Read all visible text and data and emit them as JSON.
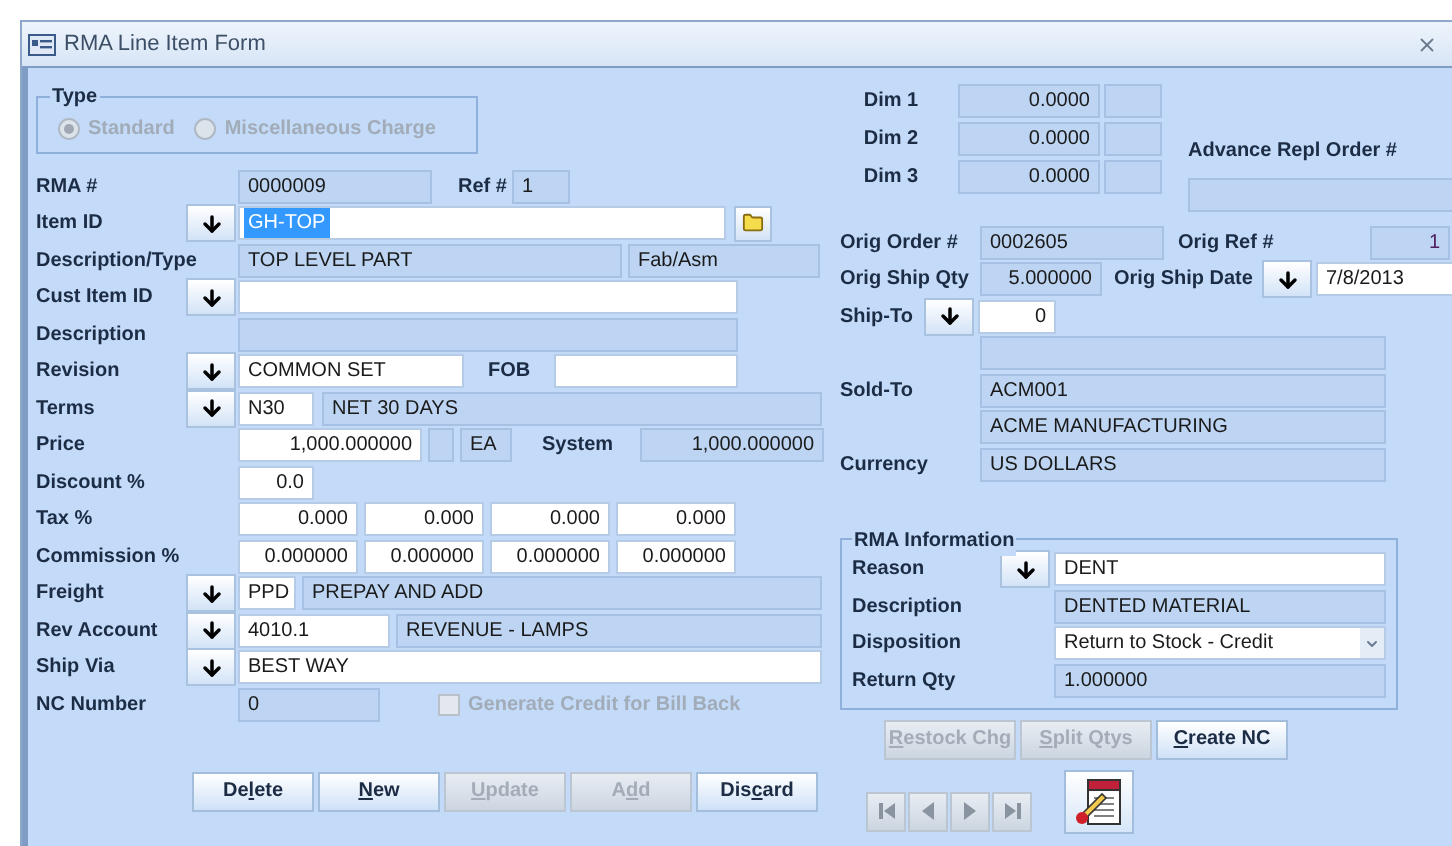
{
  "window": {
    "title": "RMA Line Item Form"
  },
  "type_group": {
    "label": "Type",
    "disabled": true,
    "options": [
      {
        "label": "Standard",
        "selected": true
      },
      {
        "label": "Miscellaneous Charge",
        "selected": false
      }
    ]
  },
  "rma": {
    "label": "RMA #",
    "value": "0000009",
    "ref_label": "Ref #",
    "ref_value": "1"
  },
  "item_id": {
    "label": "Item ID",
    "value": "GH-TOP",
    "text_selected": true
  },
  "description_type": {
    "label": "Description/Type",
    "description": "TOP LEVEL PART",
    "type": "Fab/Asm"
  },
  "cust_item_id": {
    "label": "Cust Item ID"
  },
  "description": {
    "label": "Description"
  },
  "revision": {
    "label": "Revision",
    "value": "COMMON SET",
    "fob_label": "FOB"
  },
  "terms": {
    "label": "Terms",
    "code": "N30",
    "name": "NET 30 DAYS"
  },
  "price": {
    "label": "Price",
    "value": "1,000.000000",
    "unit": "EA",
    "system_label": "System",
    "system_value": "1,000.000000"
  },
  "discount": {
    "label": "Discount %",
    "value": "0.0"
  },
  "tax": {
    "label": "Tax %",
    "values": [
      "0.000",
      "0.000",
      "0.000",
      "0.000"
    ]
  },
  "commission": {
    "label": "Commission %",
    "values": [
      "0.000000",
      "0.000000",
      "0.000000",
      "0.000000"
    ]
  },
  "freight": {
    "label": "Freight",
    "code": "PPD",
    "name": "PREPAY AND ADD"
  },
  "rev_account": {
    "label": "Rev Account",
    "code": "4010.1",
    "name": "REVENUE - LAMPS"
  },
  "ship_via": {
    "label": "Ship Via",
    "value": "BEST WAY"
  },
  "nc_number": {
    "label": "NC Number",
    "value": "0"
  },
  "bill_back": {
    "label": "Generate Credit for Bill Back",
    "checked": false,
    "disabled": true
  },
  "buttons": [
    {
      "before": "De",
      "key": "l",
      "after": "ete",
      "disabled": false
    },
    {
      "key": "N",
      "after": "ew",
      "disabled": false
    },
    {
      "key": "U",
      "after": "pdate",
      "disabled": true
    },
    {
      "before": "A",
      "key": "d",
      "after": "d",
      "disabled": true
    },
    {
      "before": "Dis",
      "key": "c",
      "after": "ard",
      "disabled": false
    }
  ],
  "dims": [
    {
      "label": "Dim 1",
      "value": "0.0000"
    },
    {
      "label": "Dim 2",
      "value": "0.0000"
    },
    {
      "label": "Dim 3",
      "value": "0.0000"
    }
  ],
  "advance_repl_order": {
    "label": "Advance Repl Order #"
  },
  "orig_order": {
    "label": "Orig Order #",
    "value": "0002605",
    "ref_label": "Orig Ref #",
    "ref_value": "1"
  },
  "orig_ship": {
    "qty_label": "Orig Ship Qty",
    "qty": "5.000000",
    "date_label": "Orig Ship Date",
    "date": "7/8/2013"
  },
  "ship_to": {
    "label": "Ship-To",
    "value": "0"
  },
  "sold_to": {
    "label": "Sold-To",
    "code": "ACM001",
    "name": "ACME MANUFACTURING"
  },
  "currency": {
    "label": "Currency",
    "value": "US DOLLARS"
  },
  "rma_information": {
    "title": "RMA Information",
    "reason_label": "Reason",
    "reason": "DENT",
    "description_label": "Description",
    "description": "DENTED MATERIAL",
    "disposition_label": "Disposition",
    "disposition": "Return to Stock - Credit",
    "return_qty_label": "Return Qty",
    "return_qty": "1.000000"
  },
  "action_buttons": [
    {
      "key": "R",
      "after": "estock Chg",
      "disabled": true
    },
    {
      "key": "S",
      "after": "plit Qtys",
      "disabled": true
    },
    {
      "key": "C",
      "after": "reate NC",
      "disabled": false
    }
  ],
  "navigation": {
    "disabled": true
  }
}
